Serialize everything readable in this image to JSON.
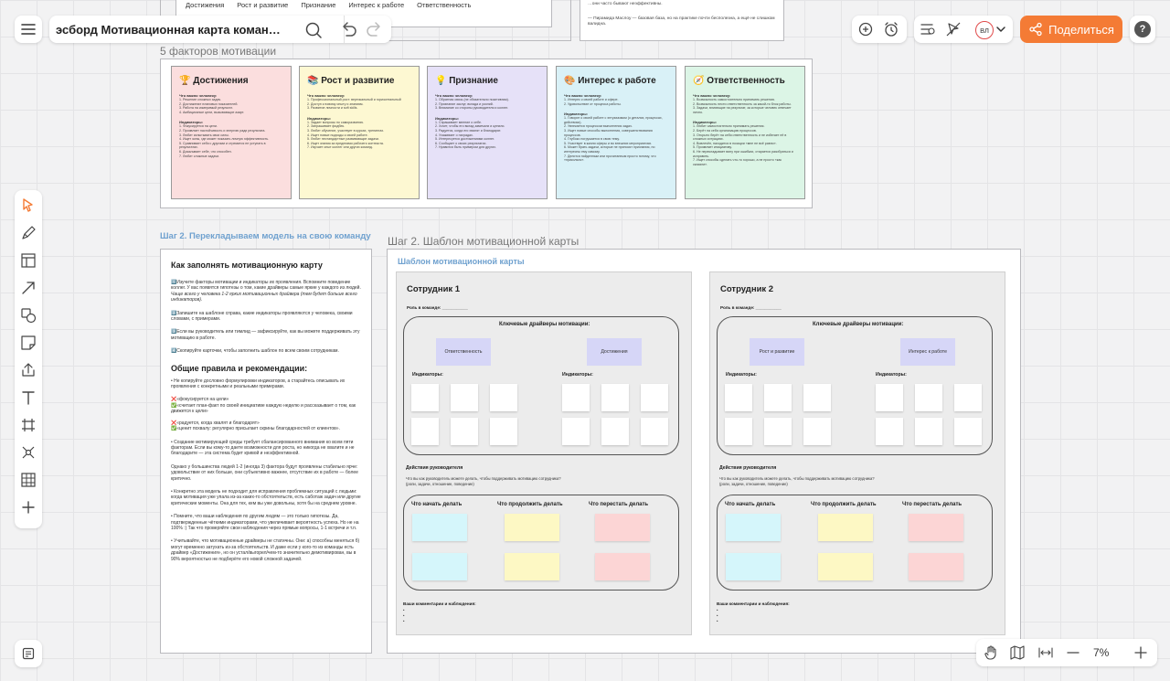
{
  "app": {
    "board_title": "эсборд  Мотивационная карта коман…",
    "share_label": "Поделиться",
    "avatar_initials": "ВЛ",
    "zoom": "7%",
    "accent_color": "#f47b35"
  },
  "top_stub": {
    "chips": [
      "Достижения",
      "Рост и развитие",
      "Признание",
      "Интерес к работе",
      "Ответственность"
    ],
    "right_text_1": "…они часто бывают неэффективны.",
    "right_text_2": "— Пирамида Маслоу — базовая база, но на практике почти бесполезна, а ещё не слишком валидна."
  },
  "factors": {
    "frame_title": "5 факторов мотивации",
    "cards": [
      {
        "title": "🏆 Достижения",
        "color": "#fbdede",
        "important_label": "Что важно человеку:",
        "important": [
          "1. Решение сложных задач.",
          "2. Достижение плановых показателей.",
          "3. Работа на измеримый результат.",
          "4. Амбициозные цели, вызывающие азарт."
        ],
        "indicators_label": "Индикаторы:",
        "indicators": [
          "1. Фокусируется на цели.",
          "2. Проявляет настойчивость и энергию ради результата.",
          "3. Любит испытывать свои силы.",
          "4. Ищет зоны, где может показать личную эффективность.",
          "5. Сравнивает себя с другими и стремится не уступать в результатах.",
          "6. Докazывает себе, что способен.",
          "7. Любит сложные задачи."
        ]
      },
      {
        "title": "📚 Рост и развитие",
        "color": "#fdf8d2",
        "important_label": "Что важно человеку:",
        "important": [
          "1. Профессиональный рост: вертикальный и горизонтальный",
          "2. Доступ к новому опыту и знаниям.",
          "3. Развитие личности и soft skills."
        ],
        "indicators_label": "Индикаторы:",
        "indicators": [
          "1. Задает вопросы по саморазвитию.",
          "2. Запрашивает фидбек.",
          "3. Любит обучение, участвует в курсах, тренингах.",
          "4. Ищет новые подходы к своей работе.",
          "5. Любит нестандартные развивающие задачи.",
          "6. Ищет знания за пределами рабочего контекста.",
          "7. Изучает опыт коллег или других команд."
        ]
      },
      {
        "title": "💡 Признание",
        "color": "#e6e1f8",
        "important_label": "Что важно человеку:",
        "important": [
          "1. Обратная связь (не обязательно позитивная).",
          "2. Признание заслуг, вклада и усилий.",
          "3. Внимание со стороны руководителя и коллег."
        ],
        "indicators_label": "Индикаторы:",
        "indicators": [
          "1. Спрашивает мнение о себе.",
          "2. Хочет, чтобы его вклад замечали и ценили.",
          "3. Радуется, когда его хвалят и благодарят.",
          "4. Ухаживает о наградах.",
          "5. Интересуется достижениями коллег.",
          "6. Сообщает о своих результатах.",
          "7. Нравится быть примером для других."
        ]
      },
      {
        "title": "🎨 Интерес к работе",
        "color": "#d9f1f7",
        "important_label": "Что важно человеку:",
        "important": [
          "1. Интерес к своей работе и сфере.",
          "2. Удовольствие от процесса работы."
        ],
        "indicators_label": "Индикаторы:",
        "indicators": [
          "1. Говорит о своей работе с энтузиазмом (о деталях, процессах, действиях).",
          "2. Увлекается процессом выполнения задач.",
          "3. Ищет новые способы выполнения, совершенствования процессов.",
          "4. Глубоко погружается в свою тему.",
          "5. Участвует в жизни сферы и во внешних мероприятиях.",
          "6. Может брать задачи, которые не приносят признания, но интересны ему самому.",
          "7. Делится найденным или прочитанным просто потому, что «прикольно»."
        ]
      },
      {
        "title": "🧭 Ответственность",
        "color": "#dcf5e6",
        "important_label": "Что важно человеку:",
        "important": [
          "1. Возможность самостоятельно принимать решения.",
          "2. Возможность нести ответственность за какой-то блок работы.",
          "3. Задачи, влияющие на результат, за которые человек отвечает лично."
        ],
        "indicators_label": "Индикаторы:",
        "indicators": [
          "1. Любит самостоятельно принимать решения.",
          "2. Берёт на себя организацию процессов.",
          "3. Открыто берёт на себя ответственность и не избегает её в сложных ситуациях.",
          "4. Вовлечён, находится в позиции «мне не всё равно».",
          "5. Проявляет инициативу.",
          "6. Не перекладывает вину при ошибках, старается разобраться и исправить.",
          "7. Ищет способы сделать что-то хорошо, а не просто «как сказали»."
        ]
      }
    ]
  },
  "step2": {
    "blue_heading": "Шаг 2. Перекладываем модель на свою команду",
    "template_frame_title": "Шаг 2. Шаблон мотивационной карты",
    "template_heading": "Шаблон мотивационной карты"
  },
  "instructions": {
    "title": "Как заполнять мотивационную карту",
    "p1": "1️⃣Изучите факторы мотивации и индикаторы их проявления. Вспомните поведение коллег. У вас появятся гипотезы о том, какие драйверы самые яркие у каждого из людей.",
    "p1b": "Чаще всего у человека 1-2 ярких мотивационных драйвера (тем будет больше всего индикаторов).",
    "p2": "2️⃣Запишите на шаблоне справа, какие индикаторы проявляются у человека, своими словами, с примерами.",
    "p3": "3️⃣Если вы руководитель или тимлид — зафиксируйте, как вы можете поддерживать эту мотивацию в работе.",
    "p4": "4️⃣Скопируйте карточки, чтобы заполнить шаблон по всем своим сотрудникам.",
    "rules_title": "Общие правила и рекомендации:",
    "r1": "• Не копируйте дословно формулировки индикаторов, а старайтесь описывать их проявления с конкретными и реальными примерами.",
    "r2": "❌«фокусируется на цели»",
    "r3": "✅«считает план-факт по своей инициативе каждую неделю и рассказывает о том, как движется к цели»",
    "r4": "❌«радуется, когда хвалят и благодарят»",
    "r5": "✅«ценит похвалу: регулярно присылает скрины благодарностей от клиентов».",
    "r6": "• Создание мотивирующей среды требует сбалансированного внимания ко всем пяти факторам. Если вы кому-то даете возможности для роста, но никогда не хвалите и не благодарите — эта система будет кривой и неэффективной.",
    "r7": "Однако у большинства людей 1-2 (иногда 3) фактора будут проявлены стабильно ярче: удовольствие от них больше, они субъективно важнее, отсутствие их в работе — более критично.",
    "r8": "• Конкретно эта модель не подходит для исправления проблемных ситуаций с людьми: когда мотивация уже упала из-за каких-то обстоятельств, есть саботаж задач или другие критические моменты. Она для тех, кем вы уже довольны, хотя бы на среднем уровне.",
    "r9": "• Помните, что ваши наблюдения по другим людям — это только гипотезы. Да, подтвержденные чёткими индикаторами, что увеличивает вероятность успеха. Но не на 100% :) Так что проверяйте свои наблюдения через прямые вопросы, 1-1 встречи и т.п.",
    "r10": "• Учитывайте, что мотивационные драйверы не статичны. Они: а) способны меняться б) могут временно затухать из-за обстоятельств. И даже если у кого-то из команды есть драйвер «Достижения», но он устал/выгорел/чем-то значительно демотивирован, вы в 90% вероятностью не подберёте его новой сложной задачей."
  },
  "employees": [
    {
      "title": "Сотрудник 1",
      "role_label": "Роль в команде: ___________",
      "drivers_label": "Ключевые драйверы мотивации:",
      "driver_a": "Ответственность",
      "driver_b": "Достижения",
      "indicators_label": "Индикаторы:",
      "actions_title": "Действия руководителя",
      "actions_desc": "Что вы как руководитель можете делать, чтобы поддерживать мотивацию сотрудника?",
      "actions_desc2": "(роли, задачи, отношение, поведение)",
      "col_start": "Что начать делать",
      "col_continue": "Что продолжить делать",
      "col_stop": "Что перестать делать",
      "comments_label": "Ваши комментарии и наблюдения:"
    },
    {
      "title": "Сотрудник 2",
      "role_label": "Роль в команде: ___________",
      "drivers_label": "Ключевые драйверы мотивации:",
      "driver_a": "Рост и развитие",
      "driver_b": "Интерес к работе",
      "indicators_label": "Индикаторы:",
      "actions_title": "Действия руководителя",
      "actions_desc": "Что вы как руководитель можете делать, чтобы поддерживать мотивацию сотрудника?",
      "actions_desc2": "(роли, задачи, отношение, поведение)",
      "col_start": "Что начать делать",
      "col_continue": "Что продолжить делать",
      "col_stop": "Что перестать делать",
      "comments_label": "Ваши комментарии и наблюдения:"
    }
  ],
  "sticky_colors": {
    "start": "#d5f6fb",
    "continue": "#fdf8c4",
    "stop": "#fcd5d5"
  },
  "tools": [
    "select-icon",
    "pen-icon",
    "template-icon",
    "arrow-icon",
    "shapes-icon",
    "sticky-note-icon",
    "upload-icon",
    "text-icon",
    "frame-icon",
    "mindmap-icon",
    "table-icon",
    "add-icon"
  ]
}
